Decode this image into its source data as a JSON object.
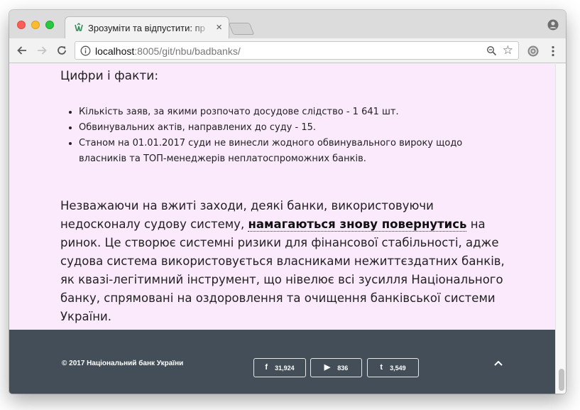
{
  "tab": {
    "title": "Зрозуміти та відпустити: пр",
    "close_glyph": "×"
  },
  "toolbar": {
    "url_host": "localhost",
    "url_rest": ":8005/git/nbu/badbanks/",
    "star_glyph": "☆"
  },
  "icons": {
    "back": "back-arrow-icon",
    "forward": "forward-arrow-icon",
    "reload": "reload-icon",
    "info": "info-icon",
    "zoom": "zoom-icon",
    "star": "bookmark-star-icon",
    "extension": "extension-icon",
    "menu": "kebab-menu-icon",
    "profile": "profile-icon",
    "to_top": "chevron-up-icon"
  },
  "content": {
    "facts_heading": "Цифри і факти:",
    "facts": [
      "Кількість заяв, за якими розпочато досудове слідство - 1 641 шт.",
      "Обвинувальних актів, направлених до суду - 15.",
      "Станом на 01.01.2017 суди не винесли жодного обвинувального вироку щодо власників та ТОП-менеджерів неплатоспроможних банків."
    ],
    "paragraph_before": "Незважаючи на вжиті заходи, деякі банки, використовуючи недосконалу судову систему, ",
    "paragraph_link": "намагаються знову повернутись",
    "paragraph_after": " на ринок. Це створює системні ризики для фінансової стабільності, адже судова система використовується власниками нежиттєздатних банків, як квазі-легітимний інструмент, що нівелює всі зусилля Національного банку, спрямовані на оздоровлення та очищення банківської системи України."
  },
  "footer": {
    "copyright": "© 2017 Національний банк України",
    "share": {
      "facebook_glyph": "f",
      "facebook_count": "31,924",
      "youtube_glyph": "▶",
      "youtube_count": "836",
      "twitter_glyph": "t",
      "twitter_count": "3,549"
    }
  },
  "colors": {
    "page_background": "#fbe9fc",
    "footer_background": "#434e58",
    "text": "#222222"
  }
}
